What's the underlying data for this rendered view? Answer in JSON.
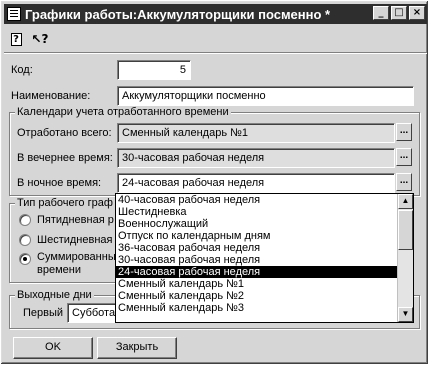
{
  "window": {
    "title": "Графики работы:Аккумуляторщики посменно *",
    "buttons": {
      "minimize": "_",
      "maximize": "□",
      "close": "×"
    }
  },
  "toolbar": {
    "help_icon": "help-icon",
    "whatsthis_icon": "whats-this-icon",
    "help_glyph": "?",
    "whatsthis_glyph": "↖?"
  },
  "form": {
    "code_label": "Код:",
    "code_value": "5",
    "name_label": "Наименование:",
    "name_value": "Аккумуляторщики посменно"
  },
  "calendars": {
    "group_title": "Календари учета отработанного времени",
    "total_label": "Отработано всего:",
    "total_value": "Сменный календарь №1",
    "evening_label": "В вечернее время:",
    "evening_value": "30-часовая рабочая неделя",
    "night_label": "В ночное время:",
    "night_value": "24-часовая рабочая неделя",
    "ellipsis": "..."
  },
  "work_type": {
    "group_title": "Тип рабочего граф",
    "options": [
      "Пятидневная р",
      "Шестидневная",
      "Суммированны",
      "времени"
    ],
    "selected_index": 2
  },
  "days_off": {
    "group_title": "Выходные дни",
    "first_label": "Первый",
    "first_value": "Суббота"
  },
  "dropdown": {
    "items": [
      "40-часовая рабочая неделя",
      "Шестидневка",
      "Военнослужащий",
      "Отпуск по календарным дням",
      "36-часовая рабочая неделя",
      "30-часовая рабочая неделя",
      "24-часовая рабочая неделя",
      "Сменный календарь №1",
      "Сменный календарь №2",
      "Сменный календарь №3"
    ],
    "selected_index": 6,
    "scroll_up": "▲",
    "scroll_down": "▼"
  },
  "buttons": {
    "ok": "OK",
    "close": "Закрыть"
  }
}
